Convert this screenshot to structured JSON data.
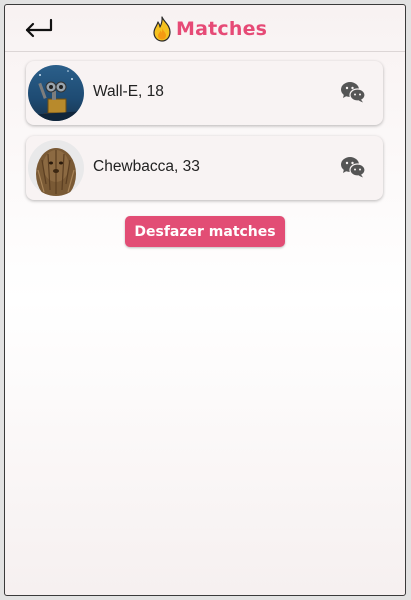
{
  "header": {
    "title": "Matches",
    "back_icon": "return-arrow-icon",
    "title_icon": "flame-icon"
  },
  "matches": [
    {
      "name": "Wall-E, 18",
      "avatar": "wall-e-photo",
      "action_icon": "wechat-icon"
    },
    {
      "name": "Chewbacca, 33",
      "avatar": "chewbacca-photo",
      "action_icon": "wechat-icon"
    }
  ],
  "actions": {
    "clear_label": "Desfazer matches"
  },
  "colors": {
    "accent": "#e64a76",
    "button": "#e24d75",
    "card": "#f8f3f3",
    "icon": "#555555"
  }
}
